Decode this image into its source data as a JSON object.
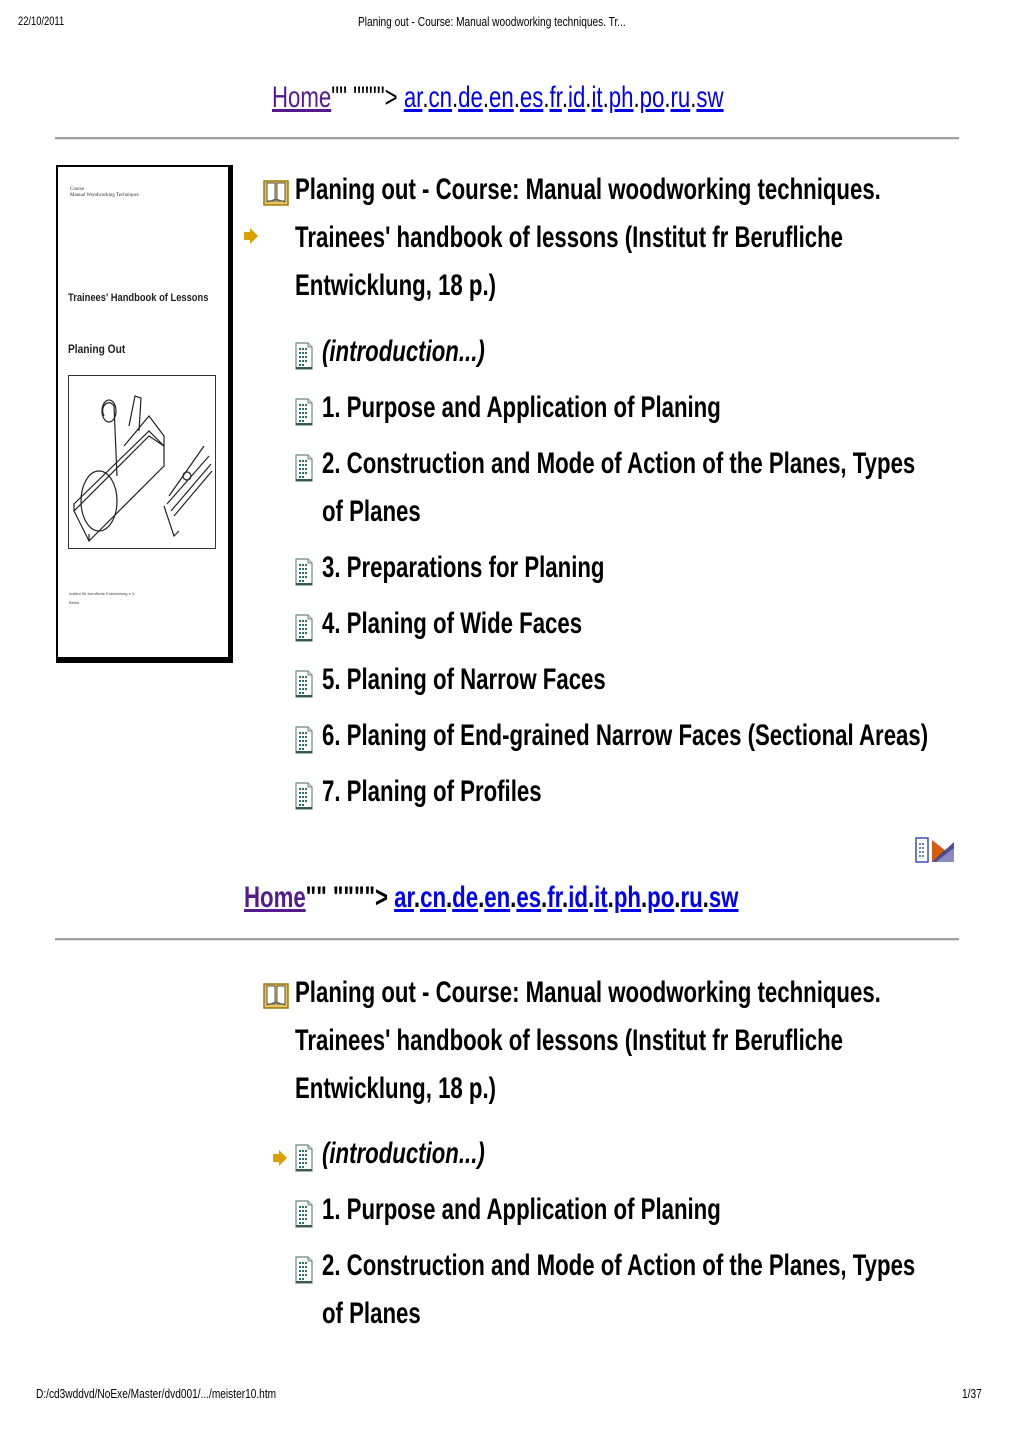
{
  "print_header": {
    "date": "22/10/2011",
    "title": "Planing out - Course: Manual woodworking techniques. Tr..."
  },
  "nav": {
    "home_label": "Home",
    "separator_text": "\"\" \"\"\"\">",
    "languages": [
      "ar",
      "cn",
      "de",
      "en",
      "es",
      "fr",
      "id",
      "it",
      "ph",
      "po",
      "ru",
      "sw"
    ]
  },
  "cover": {
    "small_text_line1": "Course",
    "small_text_line2": "Manual Woodworking Techniques",
    "heading": "Trainees' Handbook of Lessons",
    "subheading": "Planing Out",
    "footer_line1": "Institut für berufliche Entwicklung e.V.",
    "footer_line2": "Berlin"
  },
  "book": {
    "title_lines": [
      "Planing out - Course: Manual woodworking techniques.",
      "Trainees' handbook of lessons (Institut fr Berufliche",
      "Entwicklung, 18 p.)"
    ],
    "chapters": [
      {
        "label": "(introduction...)",
        "italic": true
      },
      {
        "label": "1. Purpose and Application of Planing"
      },
      {
        "label": "2. Construction and Mode of Action of the Planes, Types",
        "cont": "of Planes"
      },
      {
        "label": "3. Preparations for Planing"
      },
      {
        "label": "4. Planing of Wide Faces"
      },
      {
        "label": "5. Planing of Narrow Faces"
      },
      {
        "label": "6. Planing of End-grained Narrow Faces (Sectional Areas)"
      },
      {
        "label": "7. Planing of Profiles"
      }
    ]
  },
  "print_footer": {
    "path": "D:/cd3wddvd/NoExe/Master/dvd001/.../meister10.htm",
    "page": "1/37"
  },
  "colors": {
    "visited_link": "#551a8b",
    "link": "#0000ee",
    "arrow": "#d9a000",
    "rule": "#a0a0a0"
  }
}
